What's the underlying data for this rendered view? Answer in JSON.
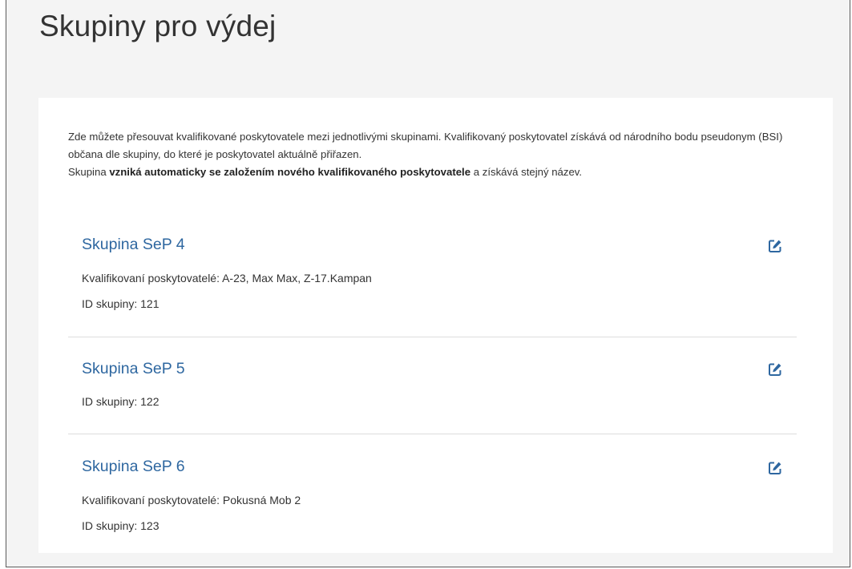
{
  "page": {
    "title": "Skupiny pro výdej"
  },
  "intro": {
    "line1": "Zde můžete přesouvat kvalifikované poskytovatele mezi jednotlivými skupinami. Kvalifikovaný poskytovatel získává od národního bodu pseudonym (BSI) občana dle skupiny, do které je poskytovatel aktuálně přiřazen.",
    "line2_prefix": "Skupina ",
    "line2_bold": "vzniká automaticky se založením nového kvalifikovaného poskytovatele",
    "line2_suffix": " a získává stejný název."
  },
  "groups": [
    {
      "name": "Skupina SeP 4",
      "providers": "Kvalifikovaní poskytovatelé: A-23, Max Max, Z-17.Kampan",
      "id_text": "ID skupiny: 121"
    },
    {
      "name": "Skupina SeP 5",
      "id_text": "ID skupiny: 122"
    },
    {
      "name": "Skupina SeP 6",
      "providers": "Kvalifikovaní poskytovatelé: Pokusná Mob 2",
      "id_text": "ID skupiny: 123"
    }
  ],
  "icons": {
    "edit": "edit-square-pencil-icon"
  },
  "colors": {
    "background": "#f4f4f4",
    "card": "#ffffff",
    "link": "#2e67a0",
    "text": "#333333",
    "divider": "#dddddd"
  }
}
